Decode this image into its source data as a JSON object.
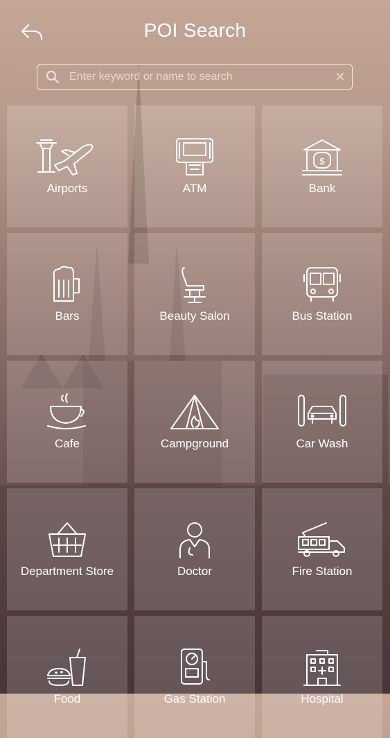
{
  "header": {
    "title": "POI Search",
    "back_icon": "back-arrow-icon"
  },
  "search": {
    "placeholder": "Enter keyword or name to search",
    "value": "",
    "clear_label": "✕"
  },
  "categories": [
    {
      "label": "Airports",
      "icon": "airport-icon"
    },
    {
      "label": "ATM",
      "icon": "atm-icon"
    },
    {
      "label": "Bank",
      "icon": "bank-icon"
    },
    {
      "label": "Bars",
      "icon": "beer-mug-icon"
    },
    {
      "label": "Beauty Salon",
      "icon": "salon-chair-icon"
    },
    {
      "label": "Bus Station",
      "icon": "bus-icon"
    },
    {
      "label": "Cafe",
      "icon": "coffee-cup-icon"
    },
    {
      "label": "Campground",
      "icon": "tent-icon"
    },
    {
      "label": "Car Wash",
      "icon": "car-wash-icon"
    },
    {
      "label": "Department Store",
      "icon": "shopping-basket-icon"
    },
    {
      "label": "Doctor",
      "icon": "doctor-icon"
    },
    {
      "label": "Fire Station",
      "icon": "fire-truck-icon"
    },
    {
      "label": "Food",
      "icon": "fast-food-icon"
    },
    {
      "label": "Gas Station",
      "icon": "gas-pump-icon"
    },
    {
      "label": "Hospital",
      "icon": "hospital-icon"
    }
  ]
}
